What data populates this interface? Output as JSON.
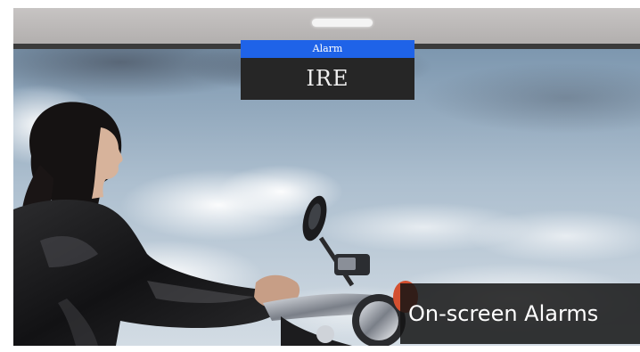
{
  "alarm": {
    "title": "Alarm",
    "value": "IRE"
  },
  "caption": "On-screen Alarms",
  "colors": {
    "alarm_header": "#1f63e8",
    "alarm_body": "#262626",
    "caption_background": "#141414",
    "monitor_bezel": "#bab7b6"
  }
}
